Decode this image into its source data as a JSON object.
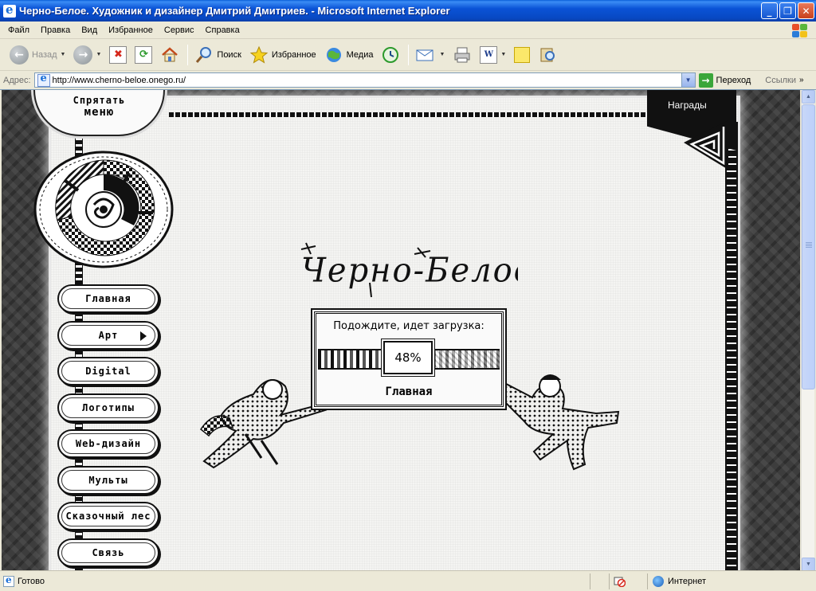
{
  "window": {
    "title": "Черно-Белое. Художник и дизайнер Дмитрий Дмитриев. - Microsoft Internet Explorer",
    "controls": {
      "minimize": "_",
      "restore": "❐",
      "close": "✕"
    }
  },
  "menu": {
    "items": [
      "Файл",
      "Правка",
      "Вид",
      "Избранное",
      "Сервис",
      "Справка"
    ]
  },
  "toolbar": {
    "back_label": "Назад",
    "search_label": "Поиск",
    "favorites_label": "Избранное",
    "media_label": "Медиа"
  },
  "address": {
    "label": "Адрес:",
    "url": "http://www.cherno-beloe.onego.ru/",
    "go_label": "Переход",
    "links_label": "Ссылки"
  },
  "site": {
    "hide_menu_line1": "Спрятать",
    "hide_menu_line2": "меню",
    "awards_label": "Награды",
    "nav": [
      {
        "label": "Главная",
        "has_submenu": false
      },
      {
        "label": "Арт",
        "has_submenu": true
      },
      {
        "label": "Digital",
        "has_submenu": false
      },
      {
        "label": "Логотипы",
        "has_submenu": false
      },
      {
        "label": "Web-дизайн",
        "has_submenu": false
      },
      {
        "label": "Мульты",
        "has_submenu": false
      },
      {
        "label": "Сказочный лес",
        "has_submenu": false
      },
      {
        "label": "Связь",
        "has_submenu": false
      }
    ],
    "logo_text": "Черно-Белое",
    "loader": {
      "message": "Подождите, идет загрузка:",
      "percent_label": "48%",
      "progress": 0.48,
      "section": "Главная"
    }
  },
  "status": {
    "text": "Готово",
    "zone": "Интернет"
  },
  "colors": {
    "xp_blue": "#0a53d6",
    "chrome": "#ece9d8",
    "ink": "#111111",
    "paper": "#f4f4f2"
  }
}
